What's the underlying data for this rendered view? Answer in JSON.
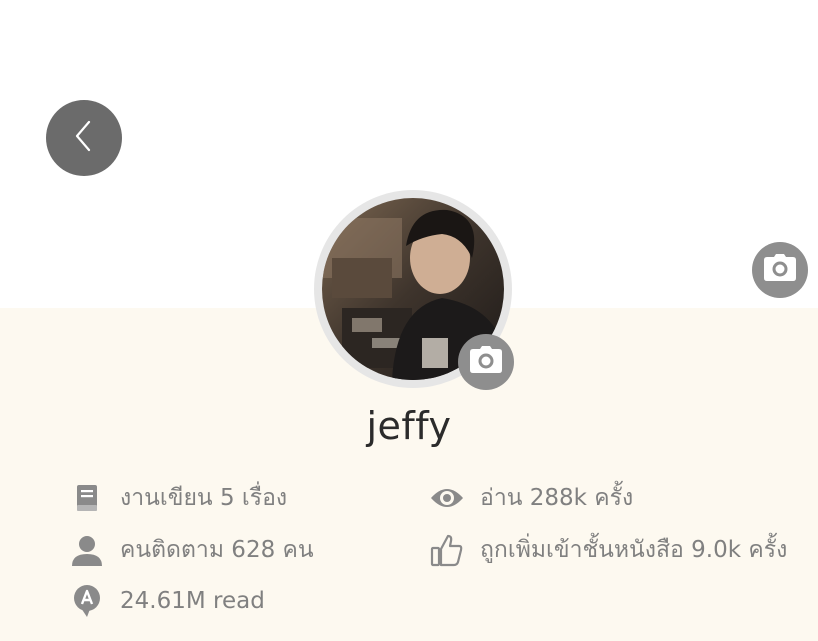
{
  "profile": {
    "username": "jeffy"
  },
  "stats": {
    "works": "งานเขียน 5 เรื่อง",
    "followers": "คนติดตาม 628 คน",
    "reads_total": "24.61M read",
    "views": "อ่าน 288k ครั้ง",
    "shelf_adds": "ถูกเพิ่มเข้าชั้นหนังสือ 9.0k ครั้ง"
  },
  "icons": {
    "back": "chevron-left-icon",
    "camera": "camera-icon",
    "works": "book-icon",
    "followers": "person-icon",
    "reads": "speech-badge-icon",
    "views": "eye-icon",
    "shelf": "thumbs-up-icon"
  },
  "colors": {
    "profile_background": "#fdf9f0",
    "button_gray": "#6b6b6b",
    "camera_gray": "#8e8e8e",
    "text_gray": "#808080",
    "name_text": "#2b2b2b"
  }
}
